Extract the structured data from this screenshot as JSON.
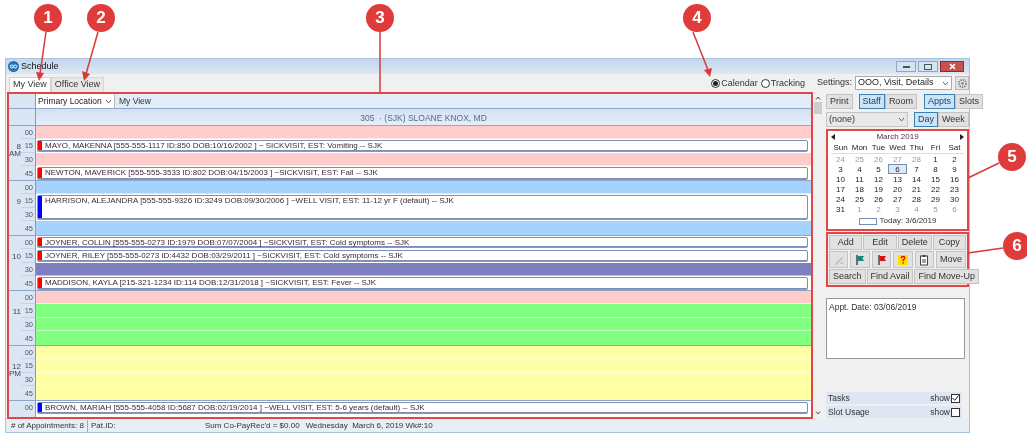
{
  "window": {
    "title": "Schedule"
  },
  "tabs": [
    {
      "label": "My View",
      "selected": true
    },
    {
      "label": "Office View",
      "selected": false
    }
  ],
  "view_modes": [
    {
      "label": "Calendar",
      "selected": true
    },
    {
      "label": "Tracking",
      "selected": false
    }
  ],
  "schedule": {
    "location": "Primary Location",
    "view": "My View",
    "provider": "305  · (SJK) SLOANE KNOX, MD",
    "hours": [
      {
        "hour": "8",
        "period": "AM",
        "slots": [
          {
            "minute": "00",
            "color": "#ffcccc"
          },
          {
            "minute": "15",
            "appointment": {
              "text": "MAYO, MAKENNA [555-555-1117 ID:850 DOB:10/16/2002 ] ~ SICKVISIT, EST: Vomiting -- SJK",
              "color": "#ff0000"
            }
          },
          {
            "minute": "30",
            "color": "#ffcccc"
          },
          {
            "minute": "45",
            "appointment": {
              "text": "NEWTON, MAVERICK [555-555-3533 ID:802 DOB:04/15/2003 ] ~SICKVISIT, EST: Fall -- SJK",
              "color": "#ff0000"
            }
          }
        ]
      },
      {
        "hour": "9",
        "slots": [
          {
            "minute": "00",
            "color": "#a6d2ff"
          },
          {
            "minute": "15",
            "appointment": {
              "text": "HARRISON, ALEJANDRA [555-555-9326 ID:3249 DOB:09/30/2006 ] ~WELL VISIT, EST: 11-12 yr F (default) -- SJK",
              "color": "#0000ff"
            }
          },
          {
            "minute": "30",
            "continued": true
          },
          {
            "minute": "45",
            "color": "#a6d2ff"
          }
        ]
      },
      {
        "hour": "10",
        "slots": [
          {
            "minute": "00",
            "appointment": {
              "text": "JOYNER, COLLIN [555-555-0273 ID:1979 DOB:07/07/2004 ] ~SICKVISIT, EST: Cold symptoms -- SJK",
              "color": "#ff0000"
            }
          },
          {
            "minute": "15",
            "appointment": {
              "text": "JOYNER, RILEY [555-555-0273 ID:4432 DOB:03/29/2011 ] ~SICKVISIT, EST: Cold symptoms -- SJK",
              "color": "#ff0000"
            }
          },
          {
            "minute": "30",
            "color": "#7f7fbf"
          },
          {
            "minute": "45",
            "appointment": {
              "text": "MADDISON, KAYLA [215-321-1234 ID:114 DOB:12/31/2018 ] ~SICKVISIT, EST: Fever -- SJK",
              "color": "#ff0000"
            }
          }
        ]
      },
      {
        "hour": "11",
        "slots": [
          {
            "minute": "00",
            "color": "#ffcccc"
          },
          {
            "minute": "15",
            "color": "#80ff80"
          },
          {
            "minute": "30",
            "color": "#80ff80"
          },
          {
            "minute": "45",
            "color": "#80ff80"
          }
        ]
      },
      {
        "hour": "12",
        "period": "PM",
        "slots": [
          {
            "minute": "00",
            "color": "#ffffa6"
          },
          {
            "minute": "15",
            "color": "#ffffa6"
          },
          {
            "minute": "30",
            "color": "#ffffa6"
          },
          {
            "minute": "45",
            "color": "#ffffa6"
          }
        ]
      },
      {
        "slots": [
          {
            "minute": "00",
            "appointment": {
              "text": "BROWN, MARIAH [555-555-4058 ID:5687 DOB:02/19/2014 ] ~WELL VISIT, EST: 5-6 years (default) -- SJK",
              "color": "#0000ff"
            }
          }
        ]
      }
    ]
  },
  "settings": {
    "label": "Settings:",
    "value": "OOO, Visit, Details"
  },
  "print_button": "Print",
  "resource_toggle": [
    {
      "label": "Staff",
      "selected": true
    },
    {
      "label": "Room",
      "selected": false
    }
  ],
  "display_toggle": [
    {
      "label": "Appts",
      "selected": true
    },
    {
      "label": "Slots",
      "selected": false
    }
  ],
  "filter": "(none)",
  "range_toggle": [
    {
      "label": "Day",
      "selected": true
    },
    {
      "label": "Week",
      "selected": false
    }
  ],
  "calendar": {
    "month": "March 2019",
    "weekdays": [
      "Sun",
      "Mon",
      "Tue",
      "Wed",
      "Thu",
      "Fri",
      "Sat"
    ],
    "weeks": [
      [
        {
          "day": "24",
          "other_month": true,
          "selected": false
        },
        {
          "day": "25",
          "other_month": true,
          "selected": false
        },
        {
          "day": "26",
          "other_month": true,
          "selected": false
        },
        {
          "day": "27",
          "other_month": true,
          "selected": false
        },
        {
          "day": "28",
          "other_month": true,
          "selected": false
        },
        {
          "day": "1",
          "other_month": false,
          "selected": false
        },
        {
          "day": "2",
          "other_month": false,
          "selected": false
        }
      ],
      [
        {
          "day": "3",
          "other_month": false,
          "selected": false
        },
        {
          "day": "4",
          "other_month": false,
          "selected": false
        },
        {
          "day": "5",
          "other_month": false,
          "selected": false
        },
        {
          "day": "6",
          "other_month": false,
          "selected": true
        },
        {
          "day": "7",
          "other_month": false,
          "selected": false
        },
        {
          "day": "8",
          "other_month": false,
          "selected": false
        },
        {
          "day": "9",
          "other_month": false,
          "selected": false
        }
      ],
      [
        {
          "day": "10",
          "other_month": false,
          "selected": false
        },
        {
          "day": "11",
          "other_month": false,
          "selected": false
        },
        {
          "day": "12",
          "other_month": false,
          "selected": false
        },
        {
          "day": "13",
          "other_month": false,
          "selected": false
        },
        {
          "day": "14",
          "other_month": false,
          "selected": false
        },
        {
          "day": "15",
          "other_month": false,
          "selected": false
        },
        {
          "day": "16",
          "other_month": false,
          "selected": false
        }
      ],
      [
        {
          "day": "17",
          "other_month": false,
          "selected": false
        },
        {
          "day": "18",
          "other_month": false,
          "selected": false
        },
        {
          "day": "19",
          "other_month": false,
          "selected": false
        },
        {
          "day": "20",
          "other_month": false,
          "selected": false
        },
        {
          "day": "21",
          "other_month": false,
          "selected": false
        },
        {
          "day": "22",
          "other_month": false,
          "selected": false
        },
        {
          "day": "23",
          "other_month": false,
          "selected": false
        }
      ],
      [
        {
          "day": "24",
          "other_month": false,
          "selected": false
        },
        {
          "day": "25",
          "other_month": false,
          "selected": false
        },
        {
          "day": "26",
          "other_month": false,
          "selected": false
        },
        {
          "day": "27",
          "other_month": false,
          "selected": false
        },
        {
          "day": "28",
          "other_month": false,
          "selected": false
        },
        {
          "day": "29",
          "other_month": false,
          "selected": false
        },
        {
          "day": "30",
          "other_month": false,
          "selected": false
        }
      ],
      [
        {
          "day": "31",
          "other_month": false,
          "selected": false
        },
        {
          "day": "1",
          "other_month": true,
          "selected": false
        },
        {
          "day": "2",
          "other_month": true,
          "selected": false
        },
        {
          "day": "3",
          "other_month": true,
          "selected": false
        },
        {
          "day": "4",
          "other_month": true,
          "selected": false
        },
        {
          "day": "5",
          "other_month": true,
          "selected": false
        },
        {
          "day": "6",
          "other_month": true,
          "selected": false
        }
      ]
    ],
    "today": "Today: 3/6/2019"
  },
  "actions": {
    "top": [
      "Add",
      "Edit",
      "Delete",
      "Copy"
    ],
    "tools": [
      {
        "kind": "pen",
        "disabled": true
      },
      {
        "kind": "green-flag",
        "disabled": false
      },
      {
        "kind": "red-flag",
        "disabled": false
      },
      {
        "kind": "help",
        "disabled": false
      },
      {
        "kind": "clipboard",
        "disabled": false
      }
    ],
    "move": "Move",
    "bottom": [
      "Search",
      "Find Avail",
      "Find Move-Up"
    ]
  },
  "notes": "Appt. Date: 03/06/2019",
  "panels": [
    {
      "label": "Tasks",
      "toggle": "show",
      "checked": true
    },
    {
      "label": "Slot Usage",
      "toggle": "show",
      "checked": false
    }
  ],
  "status_bar": [
    "# of Appointments: 8",
    "Pat.ID:",
    "Sum Co-PayRec'd = $0.00",
    "Wednesday  March 6, 2019 Wk#:10"
  ],
  "callouts": [
    {
      "label": "1"
    },
    {
      "label": "2"
    },
    {
      "label": "3"
    },
    {
      "label": "4"
    },
    {
      "label": "5"
    },
    {
      "label": "6"
    }
  ]
}
